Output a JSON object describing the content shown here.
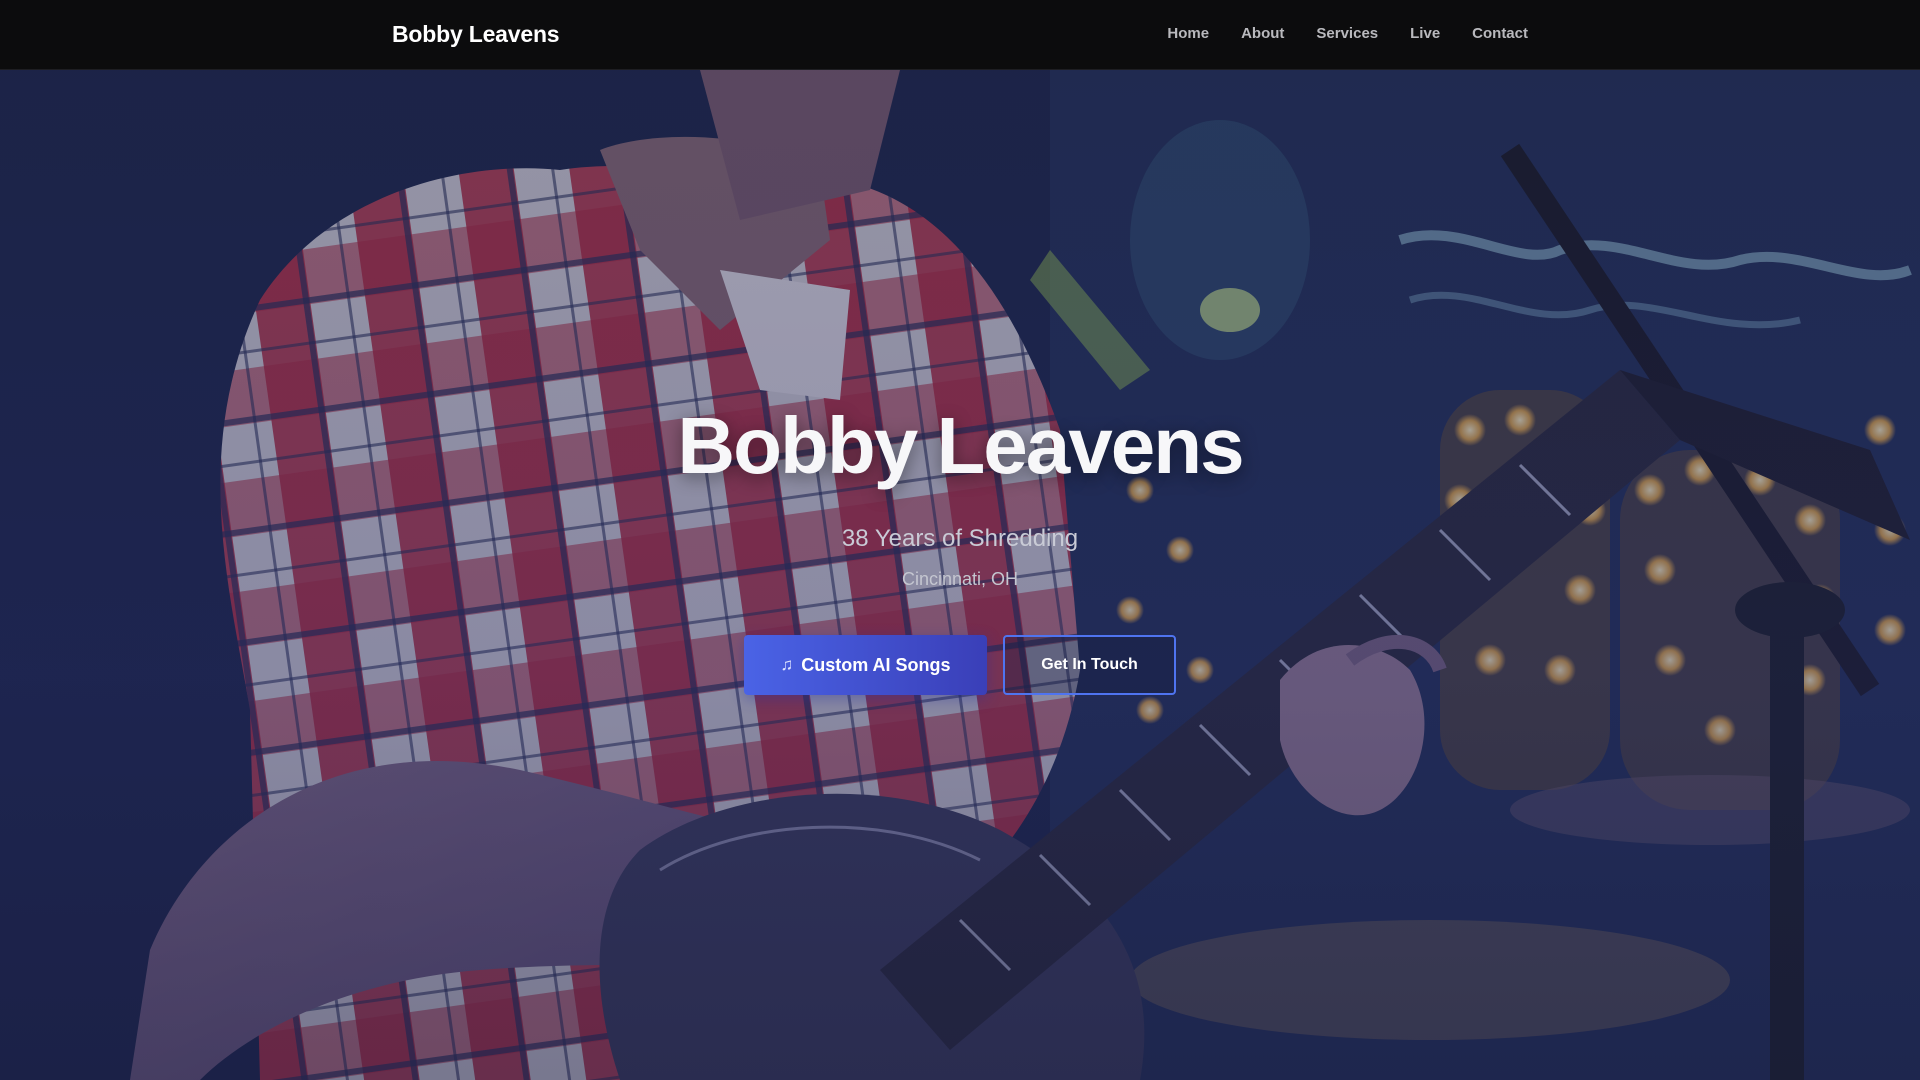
{
  "nav": {
    "brand": "Bobby Leavens",
    "links": [
      "Home",
      "About",
      "Services",
      "Live",
      "Contact"
    ]
  },
  "hero": {
    "title": "Bobby Leavens",
    "subtitle": "38 Years of Shredding",
    "location": "Cincinnati, OH",
    "primary_button": {
      "icon": "music-note-icon",
      "label": "Custom AI Songs"
    },
    "secondary_button": {
      "label": "Get In Touch"
    },
    "background_image": "guitarist-on-stage-photo"
  },
  "colors": {
    "navbar_bg": "#0c0c0d",
    "primary_button_start": "#4a63e6",
    "primary_button_end": "#3a3fb8",
    "secondary_button_border": "#4f74f0",
    "hero_overlay": "#1e2358"
  }
}
